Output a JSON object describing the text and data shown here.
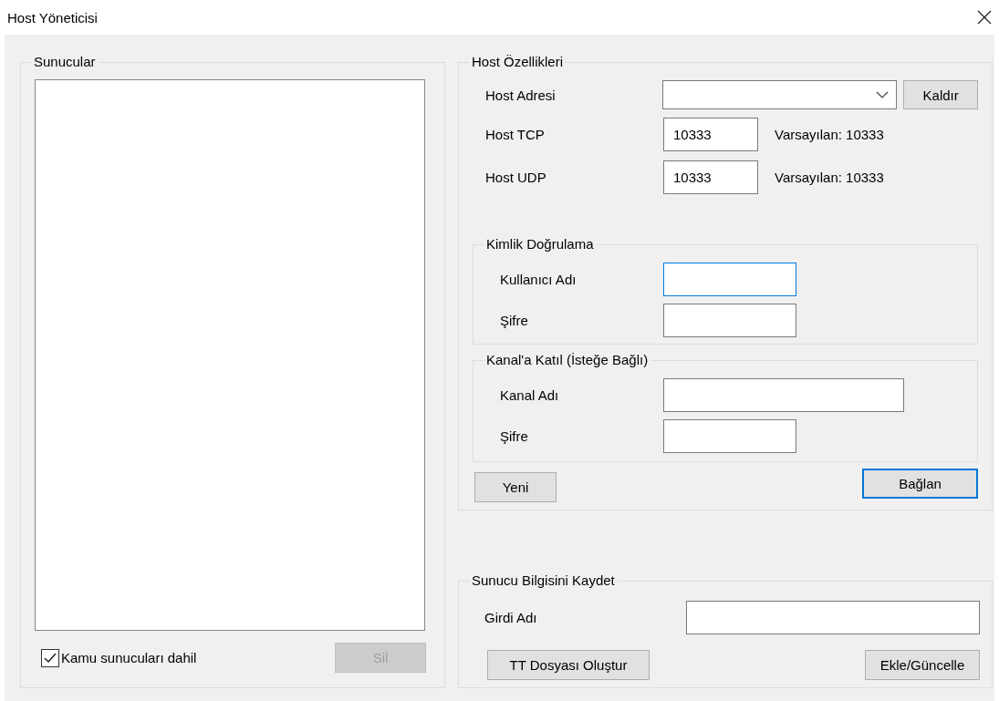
{
  "window": {
    "title": "Host Yöneticisi"
  },
  "servers": {
    "title": "Sunucular",
    "include_public": {
      "label": "Kamu sunucuları dahil",
      "checked": true
    },
    "delete_button": {
      "label": "Sil",
      "disabled": true
    }
  },
  "host_properties": {
    "title": "Host Özellikleri",
    "fields": [
      {
        "kind": "combo",
        "label": "Host Adresi",
        "button": "Kaldır"
      },
      {
        "kind": "text",
        "label": "Host TCP",
        "value": "10333",
        "note": "Varsayılan: 10333"
      },
      {
        "kind": "text",
        "label": "Host UDP",
        "value": "10333",
        "note": "Varsayılan: 10333"
      }
    ],
    "authentication": {
      "title": "Kimlik Doğrulama",
      "fields": [
        {
          "label": "Kullanıcı Adı",
          "focused": true
        },
        {
          "label": "Şifre",
          "focused": false
        }
      ]
    },
    "join_channel": {
      "title": "Kanal'a Katıl (İsteğe Bağlı)",
      "fields": [
        {
          "label": "Kanal Adı",
          "focused": false
        },
        {
          "label": "Şifre",
          "focused": false
        }
      ]
    },
    "buttons": [
      {
        "label": "Yeni",
        "default": false
      },
      {
        "label": "Bağlan",
        "default": true
      }
    ]
  },
  "save_server": {
    "title": "Sunucu Bilgisini Kaydet",
    "field_label": "Girdi Adı",
    "buttons": [
      {
        "label": "TT Dosyası Oluştur"
      },
      {
        "label": "Ekle/Güncelle"
      }
    ]
  }
}
